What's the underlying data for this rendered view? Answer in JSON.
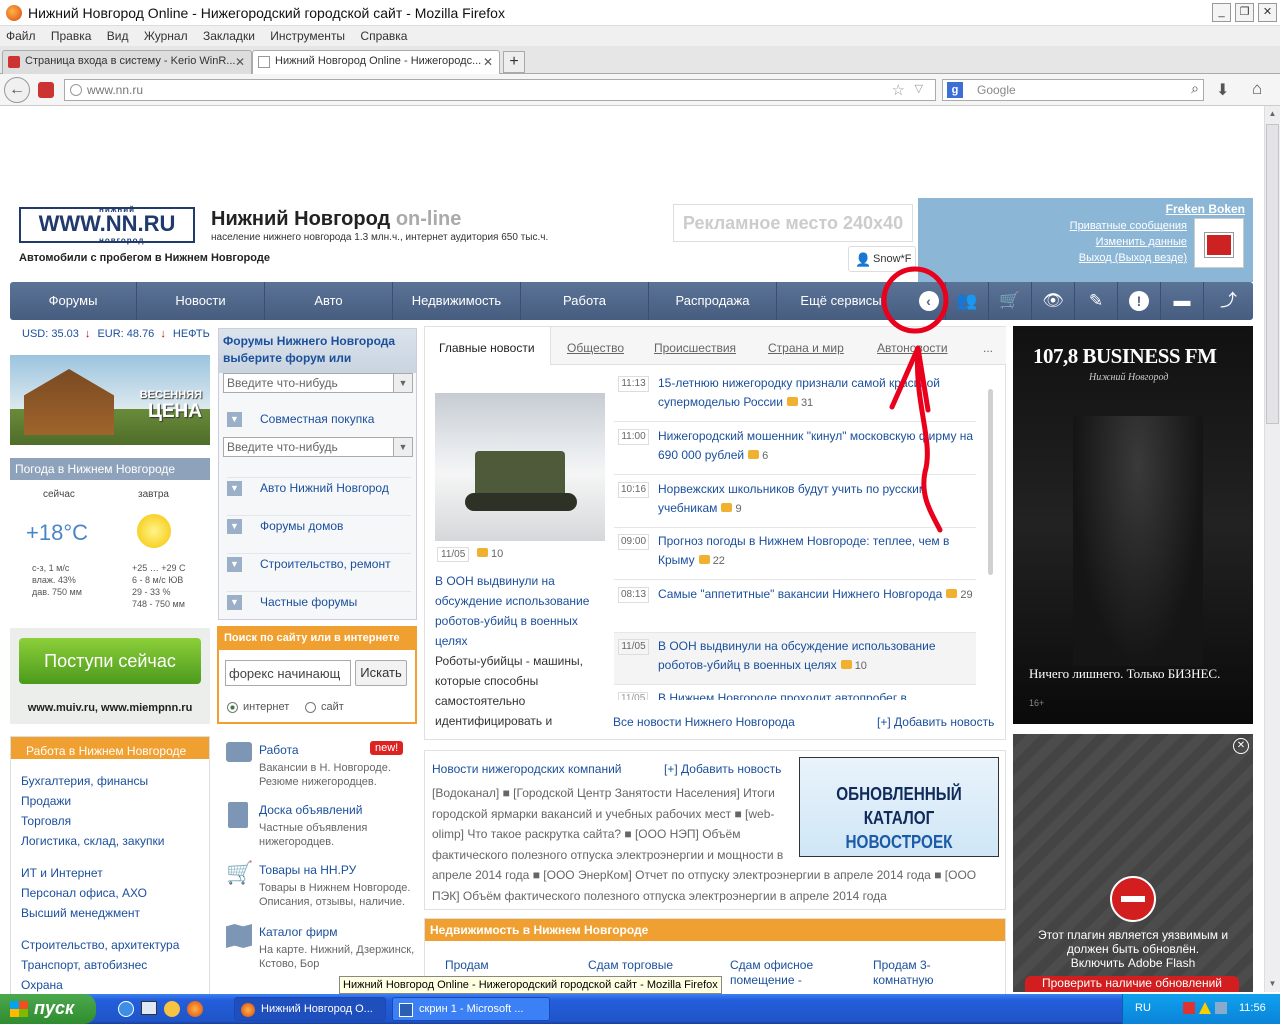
{
  "window": {
    "title": "Нижний Новгород Online - Нижегородский городской сайт - Mozilla Firefox"
  },
  "menu": [
    "Файл",
    "Правка",
    "Вид",
    "Журнал",
    "Закладки",
    "Инструменты",
    "Справка"
  ],
  "tabs": [
    {
      "label": "Страница входа в систему - Kerio WinR..."
    },
    {
      "label": "Нижний Новгород Online - Нижегородс..."
    }
  ],
  "address": {
    "url": "www.nn.ru",
    "search_placeholder": "Google"
  },
  "header": {
    "logo": "WWW.NN.RU",
    "logo_top": "нижний",
    "logo_bottom": "новгород",
    "site_title": "Нижний Новгород",
    "site_title_suffix": "on-line",
    "subtitle": "население нижнего новгорода 1.3 млн.ч., интернет аудитория 650 тыс.ч.",
    "promo_link": "Автомобили с пробегом в Нижнем Новгороде",
    "ad_placeholder": "Рекламное место 240x40",
    "user_chip": "Snow*F"
  },
  "userbox": {
    "username": "Freken Boken",
    "links": [
      "Приватные сообщения",
      "Изменить данные",
      "Выход (Выход везде)"
    ]
  },
  "nav": {
    "items": [
      "Форумы",
      "Новости",
      "Авто",
      "Недвижимость",
      "Работа",
      "Распродажа",
      "Ещё сервисы"
    ]
  },
  "rates": {
    "usd": "USD: 35.03",
    "eur": "EUR: 48.76",
    "oil": "НЕФТЬ"
  },
  "promo_banner": {
    "line1": "ВЕСЕННЯЯ",
    "line2": "ЦЕНА"
  },
  "weather": {
    "title": "Погода в Нижнем Новгороде",
    "now_label": "сейчас",
    "tomorrow_label": "завтра",
    "now_temp": "+18°C",
    "now_details": [
      "с-з, 1 м/с",
      "влаж. 43%",
      "дав. 750 мм"
    ],
    "tomorrow_details": [
      "+25 … +29 С",
      "6 - 8 м/с ЮВ",
      "29 - 33 %",
      "748 - 750 мм"
    ]
  },
  "admit_banner": {
    "button": "Поступи сейчас",
    "sites": "www.muiv.ru, www.miempnn.ru"
  },
  "jobs": {
    "title": "Работа в Нижнем Новгороде",
    "groups": [
      [
        "Бухгалтерия, финансы",
        "Продажи",
        "Торговля",
        "Логистика, склад, закупки"
      ],
      [
        "ИТ и Интернет",
        "Персонал офиса, АХО",
        "Высший менеджмент"
      ],
      [
        "Строительство, архитектура",
        "Транспорт, автобизнес",
        "Охрана"
      ]
    ]
  },
  "forums": {
    "title": "Форумы Нижнего Новгорода",
    "subtitle": "выберите форум или",
    "placeholder1": "Введите что-нибудь",
    "first_item": "Совместная покупка",
    "placeholder2": "Введите что-нибудь",
    "items": [
      "Авто Нижний Новгород",
      "Форумы домов",
      "Строительство, ремонт",
      "Частные форумы"
    ]
  },
  "search": {
    "title": "Поиск по сайту или в интернете",
    "query": "форекс начинающ",
    "button": "Искать",
    "opt1": "интернет",
    "opt2": "сайт"
  },
  "services": [
    {
      "title": "Работа",
      "badge": "new!",
      "desc": "Вакансии в Н. Новгороде. Резюме нижегородцев."
    },
    {
      "title": "Доска объявлений",
      "desc": "Частные объявления нижегородцев."
    },
    {
      "title": "Товары на НН.РУ",
      "desc": "Товары в Нижнем Новгороде. Описания, отзывы, наличие."
    },
    {
      "title": "Каталог фирм",
      "desc": "На карте. Нижний, Дзержинск, Кстово, Бор"
    }
  ],
  "news": {
    "tabs": [
      "Главные новости",
      "Общество",
      "Происшествия",
      "Страна и мир",
      "Автоновости",
      "..."
    ],
    "featured": {
      "date": "11/05",
      "comments": "10",
      "title": "В ООН выдвинули на обсуждение использование роботов-убийц в военных целях",
      "text": "Роботы-убийцы - машины, которые способны самостоятельно идентифицировать и"
    },
    "items": [
      {
        "time": "11:13",
        "title": "15-летнюю нижегородку признали самой красивой супермоделью России",
        "comments": "31"
      },
      {
        "time": "11:00",
        "title": "Нижегородский мошенник \"кинул\" московскую фирму на 690 000 рублей",
        "comments": "6"
      },
      {
        "time": "10:16",
        "title": "Норвежских школьников будут учить по русским учебникам",
        "comments": "9"
      },
      {
        "time": "09:00",
        "title": "Прогноз погоды в Нижнем Новгороде: теплее, чем в Крыму",
        "comments": "22"
      },
      {
        "time": "08:13",
        "title": "Самые \"аппетитные\" вакансии Нижнего Новгорода",
        "comments": "29"
      },
      {
        "time": "11/05",
        "title": "В ООН выдвинули на обсуждение использование роботов-убийц в военных целях",
        "comments": "10"
      },
      {
        "time": "11/05",
        "title": "В Нижнем Новгороде проходит автопробег в",
        "comments": ""
      }
    ],
    "all_link": "Все новости Нижнего Новгорода",
    "add_link": "[+] Добавить новость"
  },
  "companies": {
    "title": "Новости нижегородских компаний",
    "add_link": "[+] Добавить новость",
    "text": "[Водоканал] ■ [Городской Центр Занятости Населения] Итоги городской ярмарки вакансий и учебных рабочих мест ■ [web-olimp] Что такое раскрутка сайта? ■ [ООО НЭП] Объём фактического полезного отпуска электроэнергии и мощности в апреле 2014 года ■ [ООО ЭнерКом] Отчет по отпуску электроэнергии в апреле 2014 года ■ [ООО ПЭК] Объём фактического полезного отпуска электроэнергии в апреле 2014 года",
    "banner_line1": "ОБНОВЛЕННЫЙ КАТАЛОГ",
    "banner_line2": "НОВОСТРОЕК"
  },
  "realty": {
    "title": "Недвижимость в Нижнем Новгороде",
    "items": [
      "Продам",
      "Сдам торговые",
      "Сдам офисное помещение -",
      "Продам 3-комнатную"
    ]
  },
  "radio_ad": {
    "brand": "107,8 BUSINESS FM",
    "city": "Нижний Новгород",
    "slogan": "Ничего лишнего. Только БИЗНЕС.",
    "age": "16+"
  },
  "flash": {
    "line1": "Этот плагин является уязвимым и",
    "line2": "должен быть обновлён.",
    "enable": "Включить Adobe Flash",
    "check": "Проверить наличие обновлений"
  },
  "tooltip": "Нижний Новгород Online - Нижегородский городской сайт - Mozilla Firefox",
  "taskbar": {
    "start": "пуск",
    "tasks": [
      "Нижний Новгород О...",
      "скрин 1 - Microsoft ..."
    ],
    "lang": "RU",
    "clock": "11:56"
  },
  "colors": {
    "nav_bg": "#4f6789",
    "accent_orange": "#f0a030",
    "link": "#1a4f9c",
    "annotation_red": "#e8001c"
  }
}
